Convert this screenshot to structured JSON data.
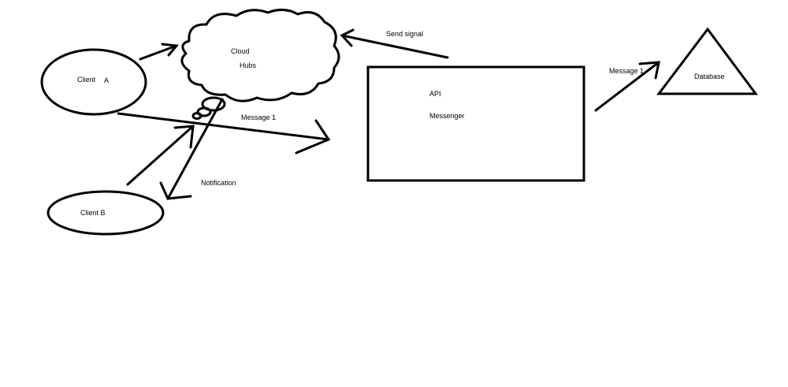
{
  "diagram": {
    "nodes": {
      "client_a": {
        "label_left": "Client",
        "label_right": "A"
      },
      "client_b": {
        "label": "Client B"
      },
      "cloud": {
        "line1": "Cloud",
        "line2": "Hubs"
      },
      "api_box": {
        "line1": "API",
        "line2": "Messenger"
      },
      "database": {
        "label": "Database"
      }
    },
    "edges": {
      "send_signal": {
        "label": "Send signal"
      },
      "client_a_to_api": {
        "label": "Message 1"
      },
      "cloud_to_client_b": {
        "label": "Notification"
      },
      "api_to_database": {
        "label": "Message 1"
      },
      "client_a_to_cloud": {
        "label": ""
      },
      "client_b_to_cloud": {
        "label": ""
      }
    },
    "colors": {
      "stroke": "#000000",
      "background": "#ffffff"
    }
  }
}
